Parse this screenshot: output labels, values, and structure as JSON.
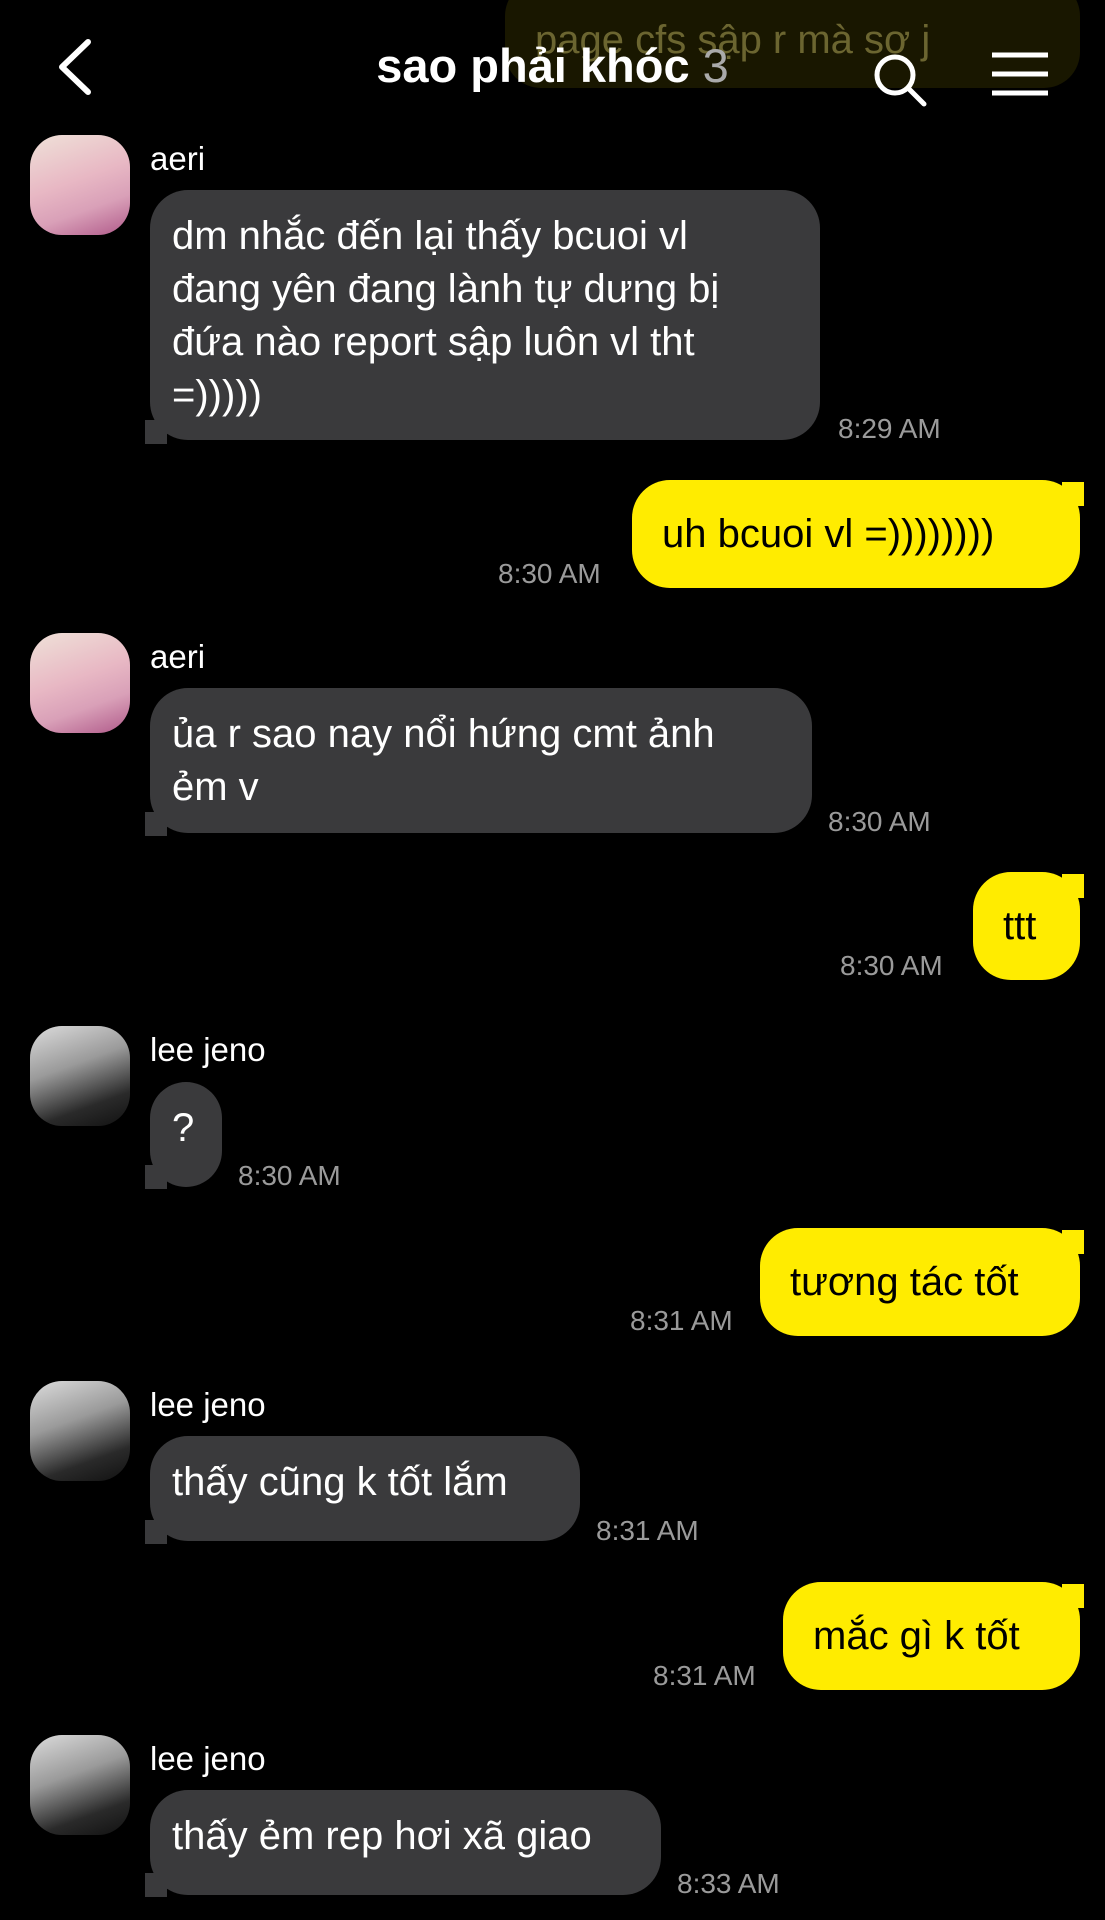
{
  "header": {
    "title": "sao phải khóc",
    "member_count": "3",
    "ghost_preview": "page cfs sập r mà sợ j",
    "icons": [
      "back-icon",
      "search-icon",
      "menu-icon"
    ]
  },
  "messages": [
    {
      "from": "aeri",
      "text": [
        "dm nhắc đến lại thấy bcuoi vl",
        "đang yên đang lành tự dưng bị",
        "đứa nào report sập luôn vl tht",
        "=)))))"
      ],
      "time": "8:29 AM"
    },
    {
      "from": "me",
      "text": "uh bcuoi vl =))))))))",
      "time": "8:30 AM"
    },
    {
      "from": "aeri",
      "text": [
        "ủa r sao nay nổi hứng cmt ảnh",
        "ẻm v"
      ],
      "time": "8:30 AM"
    },
    {
      "from": "me",
      "text": "ttt",
      "time": "8:30 AM"
    },
    {
      "from": "lee jeno",
      "text": [
        "?"
      ],
      "time": "8:30 AM"
    },
    {
      "from": "me",
      "text": "tương tác tốt",
      "time": "8:31 AM"
    },
    {
      "from": "lee jeno",
      "text": [
        "thấy cũng k tốt lắm"
      ],
      "time": "8:31 AM"
    },
    {
      "from": "me",
      "text": "mắc gì k tốt",
      "time": "8:31 AM"
    },
    {
      "from": "lee jeno",
      "text": [
        "thấy ẻm rep hơi xã giao"
      ],
      "time": "8:33 AM"
    }
  ],
  "colors": {
    "background": "#000000",
    "incoming_bubble": "#3a3a3c",
    "outgoing_bubble": "#ffec00",
    "timestamp": "#9a9a9a"
  }
}
